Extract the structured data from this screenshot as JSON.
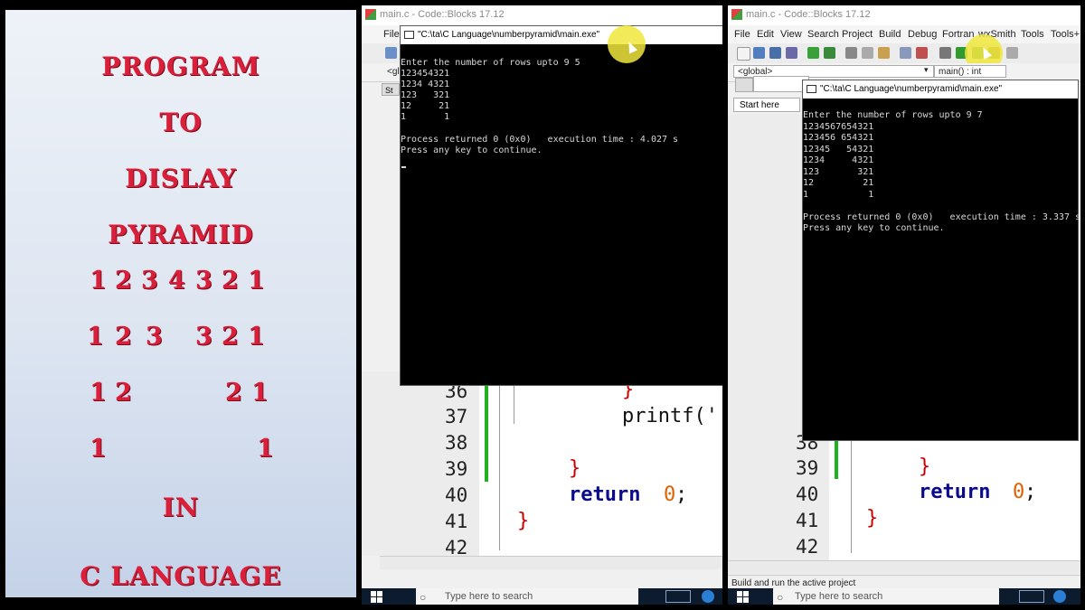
{
  "title_panel": {
    "lines": [
      "PROGRAM",
      "TO",
      "DISLAY",
      "PYRAMID"
    ],
    "pyramid_rows": [
      [
        "1",
        "2",
        "3",
        "4",
        "3",
        "2",
        "1"
      ],
      [
        "1",
        "2",
        "3",
        "3",
        "2",
        "1"
      ],
      [
        "1",
        "2",
        "2",
        "1"
      ],
      [
        "1",
        "1"
      ]
    ],
    "in_text": "IN",
    "language_text": "C LANGUAGE"
  },
  "window_left": {
    "title": "main.c - Code::Blocks 17.12",
    "menu_first": "File",
    "toolbar_frag": "<gl",
    "tab_frag": "St",
    "console_title": "\"C:\\ta\\C Language\\numberpyramid\\main.exe\"",
    "console_lines": [
      "Enter the number of rows upto 9 5",
      "123454321",
      "1234 4321",
      "123   321",
      "12     21",
      "1       1",
      "",
      "Process returned 0 (0x0)   execution time : 4.027 s",
      "Press any key to continue."
    ],
    "line_numbers": [
      "36",
      "37",
      "38",
      "39",
      "40",
      "41",
      "42"
    ],
    "code": {
      "brace1": "}",
      "printf": "printf('",
      "brace2": "}",
      "return_kw": "return",
      "return_val": "0",
      "semicolon": ";",
      "brace3": "}"
    },
    "taskbar_search": "Type here to search"
  },
  "window_right": {
    "title": "main.c - Code::Blocks 17.12",
    "menu": [
      "File",
      "Edit",
      "View",
      "Search",
      "Project",
      "Build",
      "Debug",
      "Fortran",
      "wxSmith",
      "Tools",
      "Tools+"
    ],
    "dropdown_scope": "<global>",
    "dropdown_func": "main() : int",
    "start_tab": "Start here",
    "console_title": "\"C:\\ta\\C Language\\numberpyramid\\main.exe\"",
    "console_lines": [
      "Enter the number of rows upto 9 7",
      "1234567654321",
      "123456 654321",
      "12345   54321",
      "1234     4321",
      "123       321",
      "12         21",
      "1           1",
      "",
      "Process returned 0 (0x0)   execution time : 3.337 s",
      "Press any key to continue."
    ],
    "line_numbers": [
      "38",
      "39",
      "40",
      "41",
      "42"
    ],
    "code": {
      "brace2": "}",
      "return_kw": "return",
      "return_val": "0",
      "semicolon": ";",
      "brace3": "}"
    },
    "status_text": "Build and run the active project",
    "taskbar_search": "Type here to search"
  },
  "colors": {
    "title_red": "#d91f3a",
    "keyword": "#0a0a8c",
    "brace": "#c80000",
    "number": "#e06000",
    "change_bar": "#1fb21f",
    "highlight": "#f0e63c"
  }
}
